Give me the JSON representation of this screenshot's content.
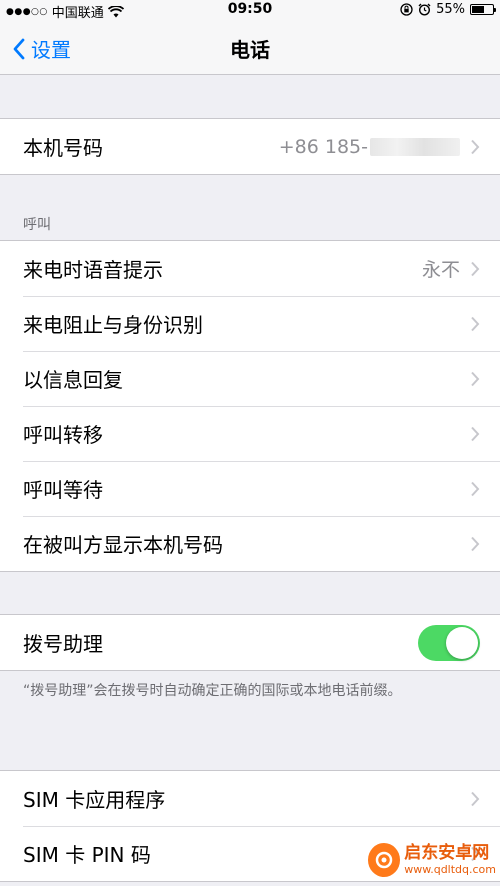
{
  "status_bar": {
    "signal_dots": "●●●○○",
    "carrier": "中国联通",
    "time": "09:50",
    "battery_percent": "55%"
  },
  "nav": {
    "back_label": "设置",
    "title": "电话"
  },
  "my_number": {
    "label": "本机号码",
    "value": "+86 185-"
  },
  "calls": {
    "header": "呼叫",
    "items": [
      {
        "label": "来电时语音提示",
        "value": "永不"
      },
      {
        "label": "来电阻止与身份识别"
      },
      {
        "label": "以信息回复"
      },
      {
        "label": "呼叫转移"
      },
      {
        "label": "呼叫等待"
      },
      {
        "label": "在被叫方显示本机号码"
      }
    ]
  },
  "dial_assist": {
    "label": "拨号助理",
    "enabled": true,
    "note": "“拨号助理”会在拨号时自动确定正确的国际或本地电话前缀。"
  },
  "sim": {
    "items": [
      {
        "label": "SIM 卡应用程序"
      },
      {
        "label": "SIM 卡 PIN 码"
      }
    ]
  },
  "watermark": {
    "name": "启东安卓网",
    "url": "www.qdltdq.com"
  },
  "colors": {
    "accent": "#007aff",
    "toggle_on": "#4cd964",
    "background": "#efeff4"
  }
}
